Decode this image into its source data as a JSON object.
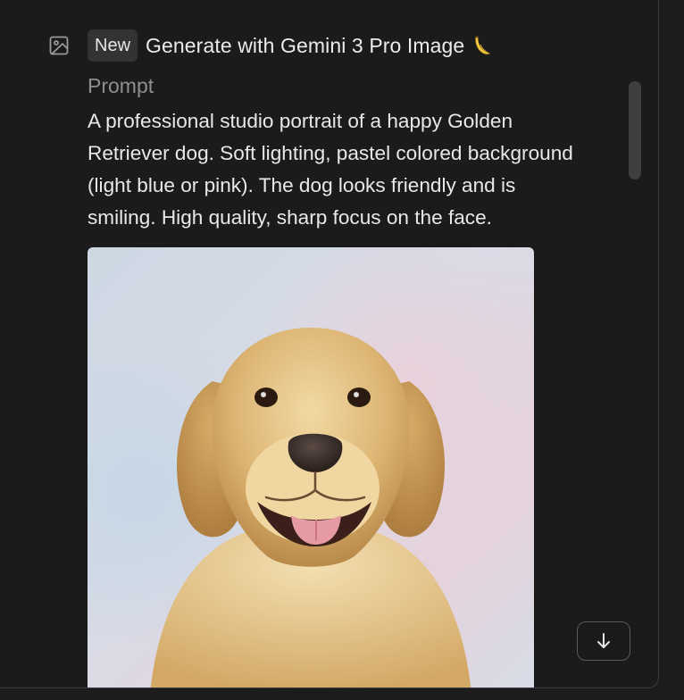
{
  "header": {
    "badge": "New",
    "title": "Generate with Gemini 3 Pro Image"
  },
  "prompt": {
    "label": "Prompt",
    "text": "A professional studio portrait of a happy Golden\nRetriever dog. Soft lighting, pastel colored background\n(light blue or pink). The dog looks friendly and is\nsmiling. High quality, sharp focus on the face."
  },
  "image": {
    "subject": "golden retriever studio portrait"
  },
  "icons": {
    "tool": "image-icon",
    "title_emoji": "banana-icon",
    "scroll": "arrow-down-icon"
  },
  "colors": {
    "background": "#1b1b1c",
    "text": "#e8e8e8",
    "muted": "#8e8e93",
    "badge_bg": "#333335"
  }
}
